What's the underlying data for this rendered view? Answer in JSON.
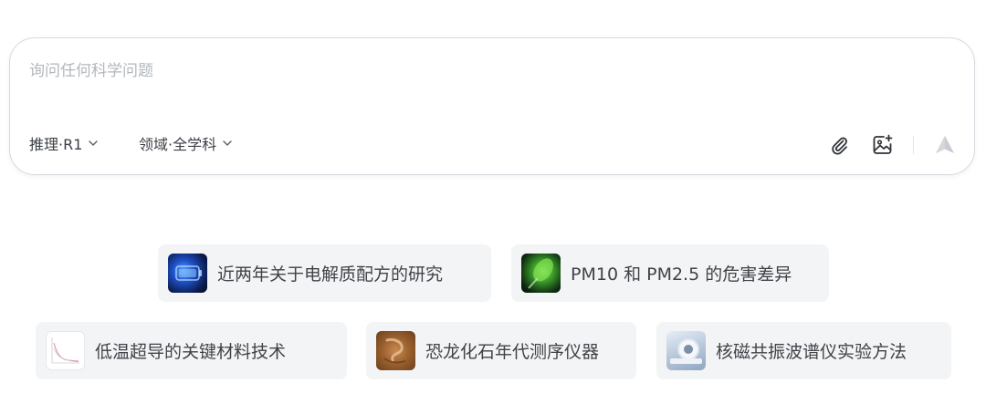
{
  "ask": {
    "placeholder": "询问任何科学问题",
    "reasoning_label": "推理·R1",
    "domain_label": "领域·全学科"
  },
  "toolbar": {
    "attach_icon": "paperclip-icon",
    "image_icon": "image-add-icon",
    "send_icon": "send-arrow-icon"
  },
  "suggestions": [
    {
      "label": "近两年关于电解质配方的研究",
      "thumb": "battery-cell-image"
    },
    {
      "label": "PM10 和 PM2.5 的危害差异",
      "thumb": "particle-tube-image"
    },
    {
      "label": "低温超导的关键材料技术",
      "thumb": "chart-thumbnail-image"
    },
    {
      "label": "恐龙化石年代测序仪器",
      "thumb": "fossil-image"
    },
    {
      "label": "核磁共振波谱仪实验方法",
      "thumb": "mri-machine-image"
    }
  ],
  "colors": {
    "border": "#d6d9de",
    "chip_bg": "#f3f4f6",
    "placeholder": "#b3b7bd",
    "text": "#3f4348"
  }
}
